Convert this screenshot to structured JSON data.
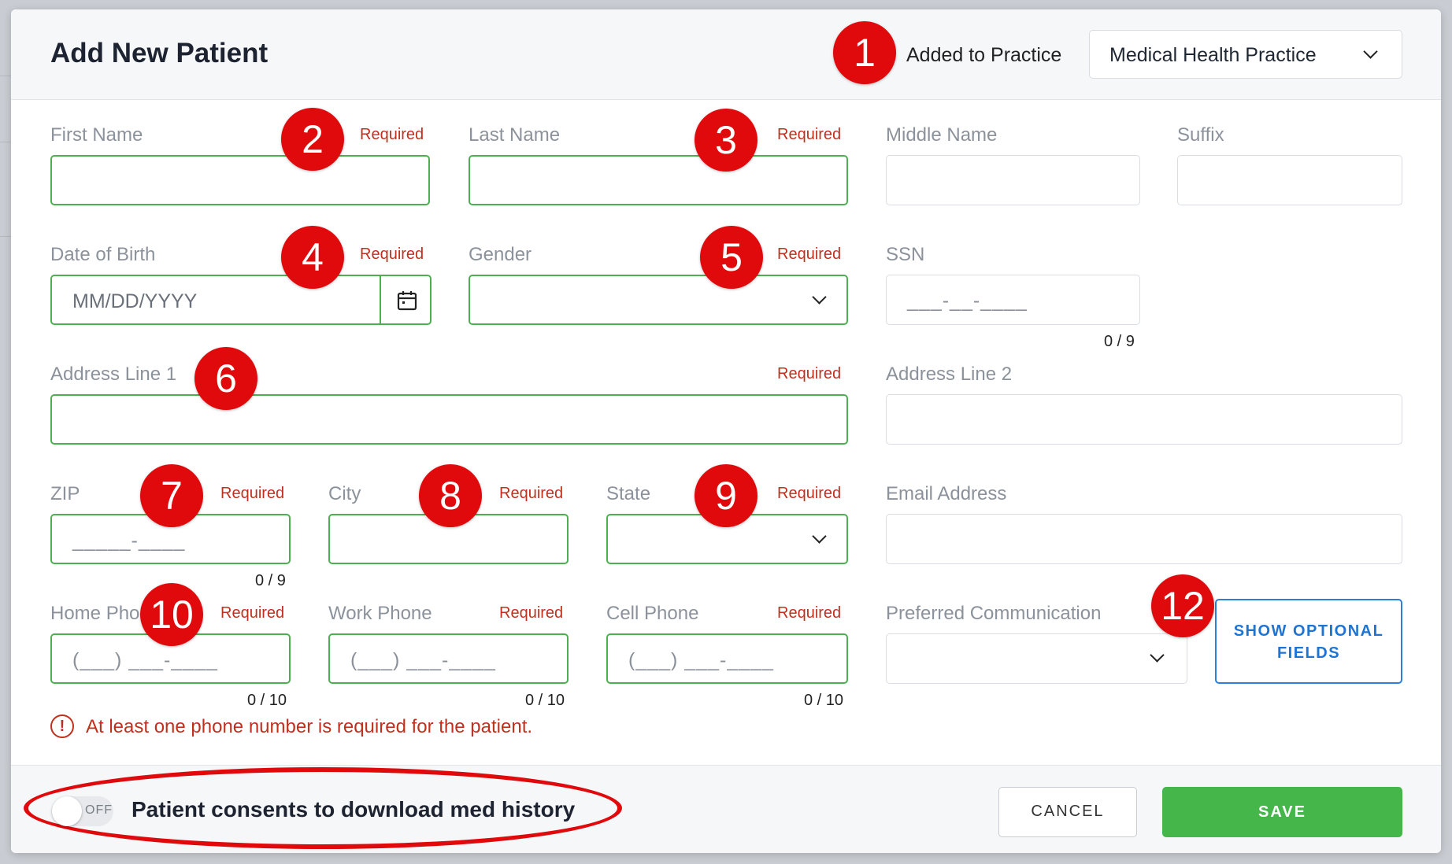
{
  "modal": {
    "title": "Add New Patient",
    "added_label": "Added to Practice",
    "practice_value": "Medical Health Practice"
  },
  "fields": {
    "first_name": {
      "label": "First Name",
      "required": "Required",
      "value": ""
    },
    "last_name": {
      "label": "Last Name",
      "required": "Required",
      "value": ""
    },
    "middle_name": {
      "label": "Middle Name",
      "value": ""
    },
    "suffix": {
      "label": "Suffix",
      "value": ""
    },
    "dob": {
      "label": "Date of Birth",
      "required": "Required",
      "placeholder": "MM/DD/YYYY"
    },
    "gender": {
      "label": "Gender",
      "required": "Required",
      "value": ""
    },
    "ssn": {
      "label": "SSN",
      "mask": "___-__-____",
      "counter": "0 / 9"
    },
    "address1": {
      "label": "Address Line 1",
      "required": "Required",
      "value": ""
    },
    "address2": {
      "label": "Address Line 2",
      "value": ""
    },
    "zip": {
      "label": "ZIP",
      "required": "Required",
      "mask": "_____-____",
      "counter": "0 / 9"
    },
    "city": {
      "label": "City",
      "required": "Required",
      "value": ""
    },
    "state": {
      "label": "State",
      "required": "Required",
      "value": ""
    },
    "email": {
      "label": "Email Address",
      "value": ""
    },
    "home_phone": {
      "label": "Home Pho",
      "required": "Required",
      "mask": "(___) ___-____",
      "counter": "0 / 10"
    },
    "work_phone": {
      "label": "Work Phone",
      "required": "Required",
      "mask": "(___) ___-____",
      "counter": "0 / 10"
    },
    "cell_phone": {
      "label": "Cell Phone",
      "required": "Required",
      "mask": "(___) ___-____",
      "counter": "0 / 10"
    },
    "preferred_comm": {
      "label": "Preferred Communication",
      "value": ""
    }
  },
  "error": {
    "icon": "!",
    "message": "At least one phone number is required for the patient."
  },
  "buttons": {
    "show_optional_line1": "SHOW OPTIONAL",
    "show_optional_line2": "FIELDS",
    "cancel": "CANCEL",
    "save": "SAVE"
  },
  "footer": {
    "toggle_state": "OFF",
    "consent_label": "Patient consents to download med history"
  },
  "annotations": [
    "1",
    "2",
    "3",
    "4",
    "5",
    "6",
    "7",
    "8",
    "9",
    "10",
    "12"
  ],
  "colors": {
    "required": "#c0301d",
    "valid_border": "#4caf50",
    "save": "#45b649",
    "accent_blue": "#1e74d2",
    "annotation": "#e0090c"
  }
}
